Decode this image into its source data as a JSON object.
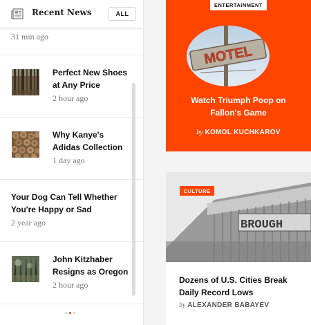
{
  "sidebar": {
    "header": {
      "icon": "news-icon",
      "title": "Recent News",
      "all_label": "ALL"
    },
    "top_time": "31 min ago",
    "items": [
      {
        "title_line1": "Perfect New Shoes",
        "title_line2": "at Any Price",
        "time": "2 hour ago",
        "thumb": "forest-thumbnail"
      },
      {
        "title_line1": "Why Kanye's",
        "title_line2": "Adidas Collection",
        "time": "1 day ago",
        "thumb": "logs-thumbnail"
      },
      {
        "title_line1": "Your Dog Can Tell Whether",
        "title_line2": "You're Happy or Sad",
        "time": "2 year ago"
      },
      {
        "title_line1": "John Kitzhaber",
        "title_line2": "Resigns as Oregon",
        "time": "2 hour ago",
        "thumb": "forest-thumbnail"
      }
    ],
    "pagination": {
      "total": 3,
      "active": 2
    }
  },
  "cards": {
    "entertainment": {
      "category": "ENTERTAINMENT",
      "sign_text": "MOTEL",
      "title_line1": "Watch Triumph Poop on",
      "title_line2": "Fallon's Game",
      "by": "by",
      "author": "KOMOL KUCHKAROV"
    },
    "culture": {
      "category": "CULTURE",
      "sign_text": "BROUGH",
      "title_line1": "Dozens of U.S. Cities Break",
      "title_line2": "Daily Record Lows",
      "by": "by",
      "author": "ALEXANDER BABAYEV"
    }
  },
  "colors": {
    "accent": "#ff4500",
    "card_bg": "#ffffff",
    "page_bg": "#f4f4f4"
  }
}
